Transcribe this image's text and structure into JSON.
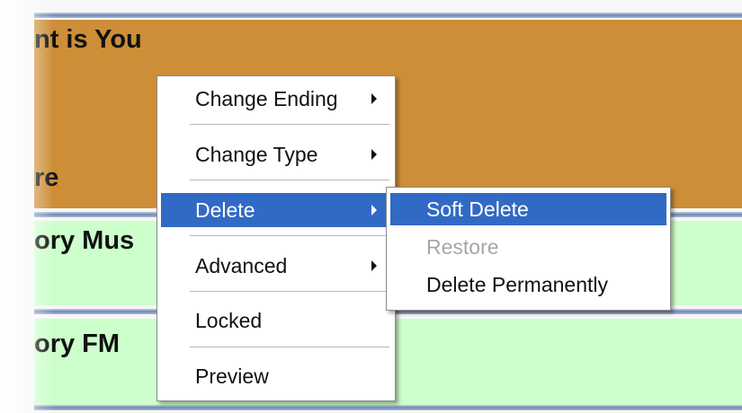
{
  "cards": [
    {
      "title": "nt is You",
      "subtitle": "re"
    },
    {
      "title": "ory Mus"
    },
    {
      "title": "ory FM"
    }
  ],
  "context_menu": {
    "items": [
      {
        "label": "Change Ending",
        "has_submenu": true
      },
      {
        "label": "Change Type",
        "has_submenu": true
      },
      {
        "label": "Delete",
        "has_submenu": true,
        "selected": true
      },
      {
        "label": "Advanced",
        "has_submenu": true
      },
      {
        "label": "Locked"
      },
      {
        "label": "Preview"
      }
    ]
  },
  "submenu": {
    "items": [
      {
        "label": "Soft Delete",
        "selected": true
      },
      {
        "label": "Restore",
        "disabled": true
      },
      {
        "label": "Delete Permanently"
      }
    ]
  },
  "colors": {
    "orange_card": "#cd8e37",
    "green_card": "#ccffcc",
    "selection": "#316ac5"
  }
}
